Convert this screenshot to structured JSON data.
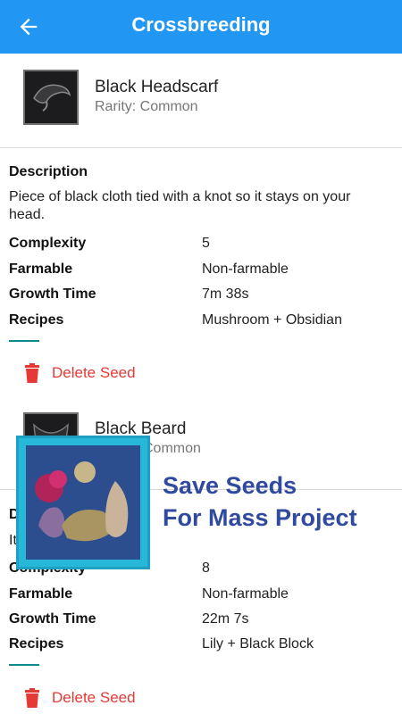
{
  "appbar": {
    "title": "Crossbreeding"
  },
  "items": [
    {
      "name": "Black Headscarf",
      "rarity": "Rarity: Common",
      "description_label": "Description",
      "description": "Piece of black cloth tied with a knot so it stays on your head.",
      "complexity_label": "Complexity",
      "complexity": "5",
      "farmable_label": "Farmable",
      "farmable": "Non-farmable",
      "growth_label": "Growth Time",
      "growth": "7m 38s",
      "recipes_label": "Recipes",
      "recipes": "Mushroom + Obsidian",
      "delete_label": "Delete Seed"
    },
    {
      "name": "Black Beard",
      "rarity": "Rarity: Common",
      "rarity_visible": "Common",
      "description_label": "D",
      "description_visible": "It",
      "complexity_label": "Complexity",
      "complexity": "8",
      "farmable_label": "Farmable",
      "farmable": "Non-farmable",
      "growth_label": "Growth Time",
      "growth": "22m 7s",
      "recipes_label": "Recipes",
      "recipes": "Lily + Black Block",
      "delete_label": "Delete Seed"
    }
  ],
  "promo": {
    "line1": "Save Seeds",
    "line2": "For Mass Project"
  },
  "colors": {
    "primary": "#2196F3",
    "delete": "#e53935",
    "accent_line": "#0e8a8a",
    "promo_text": "#2f4a9e"
  }
}
